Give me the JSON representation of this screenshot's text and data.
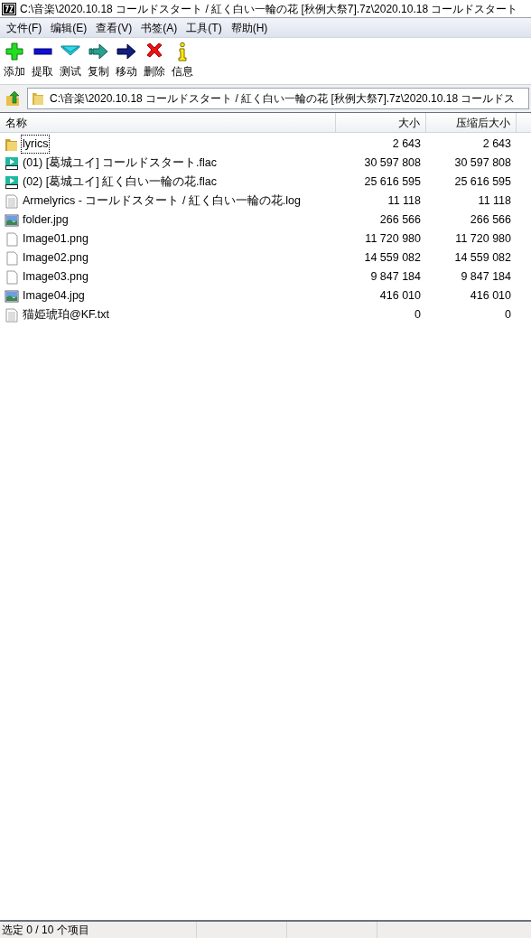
{
  "window": {
    "title": "C:\\音楽\\2020.10.18 コールドスタート / 紅く白い一輪の花 [秋例大祭7].7z\\2020.10.18 コールドスタート"
  },
  "menu": [
    "文件(F)",
    "编辑(E)",
    "查看(V)",
    "书签(A)",
    "工具(T)",
    "帮助(H)"
  ],
  "toolbar": [
    {
      "kind": "add",
      "label": "添加"
    },
    {
      "kind": "extract",
      "label": "提取"
    },
    {
      "kind": "test",
      "label": "测试"
    },
    {
      "kind": "copy",
      "label": "复制"
    },
    {
      "kind": "move",
      "label": "移动"
    },
    {
      "kind": "delete",
      "label": "删除"
    },
    {
      "kind": "info",
      "label": "信息"
    }
  ],
  "address": {
    "value": "C:\\音楽\\2020.10.18 コールドスタート / 紅く白い一輪の花 [秋例大祭7].7z\\2020.10.18 コールドス"
  },
  "table": {
    "columns": [
      "名称",
      "大小",
      "压缩后大小"
    ],
    "rows": [
      {
        "kind": "folder",
        "name": "lyrics",
        "size": "2 643",
        "packed": "2 643",
        "focused": true
      },
      {
        "kind": "flac",
        "name": "(01) [葛城ユイ] コールドスタート.flac",
        "size": "30 597 808",
        "packed": "30 597 808",
        "focused": false
      },
      {
        "kind": "flac",
        "name": "(02) [葛城ユイ] 紅く白い一輪の花.flac",
        "size": "25 616 595",
        "packed": "25 616 595",
        "focused": false
      },
      {
        "kind": "text",
        "name": "Armelyrics - コールドスタート / 紅く白い一輪の花.log",
        "size": "11 118",
        "packed": "11 118",
        "focused": false
      },
      {
        "kind": "image",
        "name": "folder.jpg",
        "size": "266 566",
        "packed": "266 566",
        "focused": false
      },
      {
        "kind": "blank",
        "name": "Image01.png",
        "size": "11 720 980",
        "packed": "11 720 980",
        "focused": false
      },
      {
        "kind": "blank",
        "name": "Image02.png",
        "size": "14 559 082",
        "packed": "14 559 082",
        "focused": false
      },
      {
        "kind": "blank",
        "name": "Image03.png",
        "size": "9 847 184",
        "packed": "9 847 184",
        "focused": false
      },
      {
        "kind": "image",
        "name": "Image04.jpg",
        "size": "416 010",
        "packed": "416 010",
        "focused": false
      },
      {
        "kind": "text",
        "name": "猫姫琥珀@KF.txt",
        "size": "0",
        "packed": "0",
        "focused": false
      }
    ]
  },
  "status_bar": "选定 0 / 10 个项目"
}
